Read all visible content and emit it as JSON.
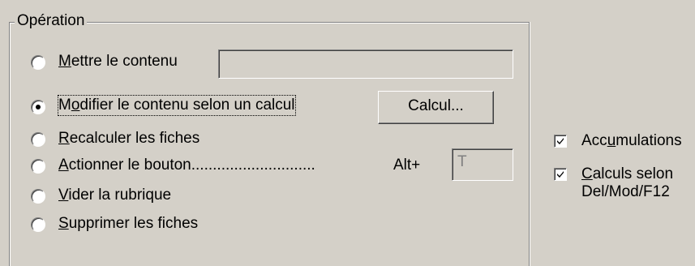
{
  "operation_group": {
    "title": "Opération",
    "options": [
      {
        "mnemonic": "M",
        "rest": "ettre le contenu",
        "checked": false
      },
      {
        "pre": "M",
        "mnemonic": "o",
        "rest": "difier le contenu selon un calcul",
        "checked": true
      },
      {
        "mnemonic": "R",
        "rest": "ecalculer les fiches",
        "checked": false
      },
      {
        "mnemonic": "A",
        "rest": "ctionner le bouton.............................",
        "checked": false
      },
      {
        "mnemonic": "V",
        "rest": "ider la rubrique",
        "checked": false
      },
      {
        "mnemonic": "S",
        "rest": "upprimer les fiches",
        "checked": false
      }
    ],
    "content_value": "",
    "calcul_button_label": "Calcul...",
    "alt_label": "Alt+",
    "alt_key_value": "T"
  },
  "options_panel": {
    "accumulations": {
      "pre": "Acc",
      "mnemonic": "u",
      "rest": "mulations",
      "checked": true
    },
    "calculs_selon": {
      "mnemonic": "C",
      "rest": "alculs selon",
      "line2": "Del/Mod/F12",
      "checked": true
    }
  }
}
